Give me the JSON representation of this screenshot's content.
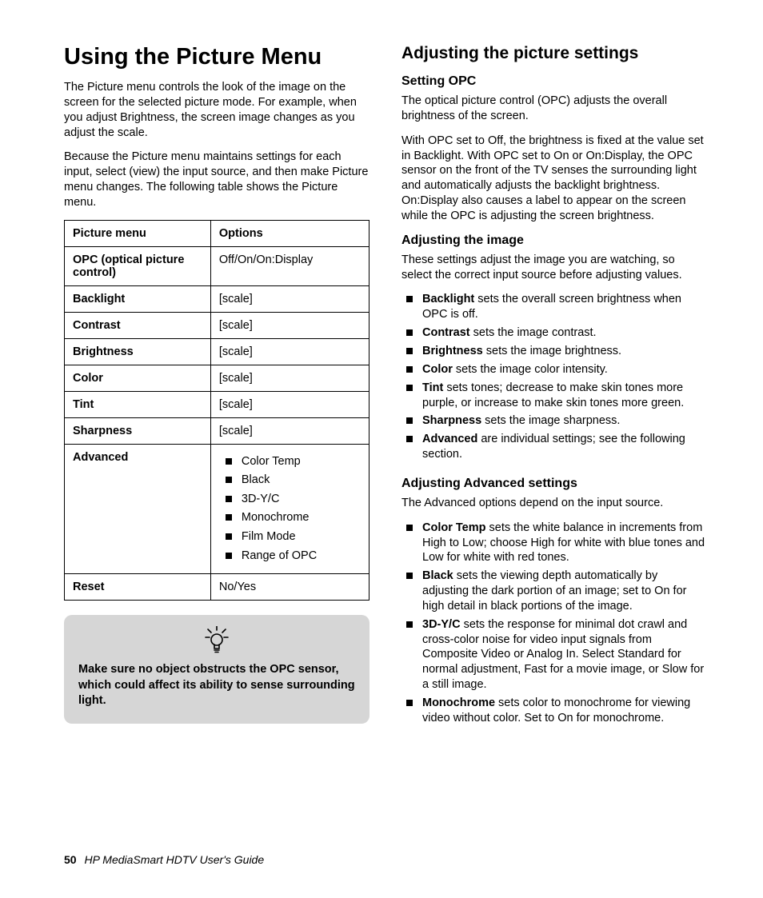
{
  "left": {
    "title": "Using the Picture Menu",
    "para1": "The Picture menu controls the look of the image on the screen for the selected picture mode. For example, when you adjust Brightness, the screen image changes as you adjust the scale.",
    "para2": "Because the Picture menu maintains settings for each input, select (view) the input source, and then make Picture menu changes. The following table shows the Picture menu.",
    "table": {
      "head_col1": "Picture menu",
      "head_col2": "Options",
      "rows": [
        {
          "name": "OPC (optical picture control)",
          "opt": "Off/On/On:Display"
        },
        {
          "name": "Backlight",
          "opt": "[scale]"
        },
        {
          "name": "Contrast",
          "opt": "[scale]"
        },
        {
          "name": "Brightness",
          "opt": "[scale]"
        },
        {
          "name": "Color",
          "opt": "[scale]"
        },
        {
          "name": "Tint",
          "opt": "[scale]"
        },
        {
          "name": "Sharpness",
          "opt": "[scale]"
        }
      ],
      "advanced_label": "Advanced",
      "advanced_items": [
        "Color Temp",
        "Black",
        "3D-Y/C",
        "Monochrome",
        "Film Mode",
        "Range of OPC"
      ],
      "reset_label": "Reset",
      "reset_opt": "No/Yes"
    },
    "tip": "Make sure no object obstructs the OPC sensor, which could affect its ability to sense surrounding light."
  },
  "right": {
    "section": "Adjusting the picture settings",
    "opc_head": "Setting OPC",
    "opc_p1": "The optical picture control (OPC) adjusts the overall brightness of the screen.",
    "opc_p2": "With OPC set to Off, the brightness is fixed at the value set in Backlight. With OPC set to On or On:Display, the OPC sensor on the front of the TV senses the surrounding light and automatically adjusts the backlight brightness. On:Display also causes a label to appear on the screen while the OPC is adjusting the screen brightness.",
    "img_head": "Adjusting the image",
    "img_p1": "These settings adjust the image you are watching, so select the correct input source before adjusting values.",
    "img_items": [
      {
        "b": "Backlight",
        "t": " sets the overall screen brightness when OPC is off."
      },
      {
        "b": "Contrast",
        "t": " sets the image contrast."
      },
      {
        "b": "Brightness",
        "t": " sets the image brightness."
      },
      {
        "b": "Color",
        "t": " sets the image color intensity."
      },
      {
        "b": "Tint",
        "t": " sets tones; decrease to make skin tones more purple, or increase to make skin tones more green."
      },
      {
        "b": "Sharpness",
        "t": " sets the image sharpness."
      },
      {
        "b": "Advanced",
        "t": " are individual settings; see the following section."
      }
    ],
    "adv_head": "Adjusting Advanced settings",
    "adv_p1": "The Advanced options depend on the input source.",
    "adv_items": [
      {
        "b": "Color Temp",
        "t": " sets the white balance in increments from High to Low; choose High for white with blue tones and Low for white with red tones."
      },
      {
        "b": "Black",
        "t": " sets the viewing depth automatically by adjusting the dark portion of an image; set to On for high detail in black portions of the image."
      },
      {
        "b": "3D-Y/C",
        "t": " sets the response for minimal dot crawl and cross-color noise for video input signals from Composite Video or Analog In. Select Standard for normal adjustment, Fast for a movie image, or Slow for a still image."
      },
      {
        "b": "Monochrome",
        "t": " sets color to monochrome for viewing video without color. Set to On for monochrome."
      }
    ]
  },
  "footer": {
    "page": "50",
    "title": "HP MediaSmart HDTV User's Guide"
  }
}
